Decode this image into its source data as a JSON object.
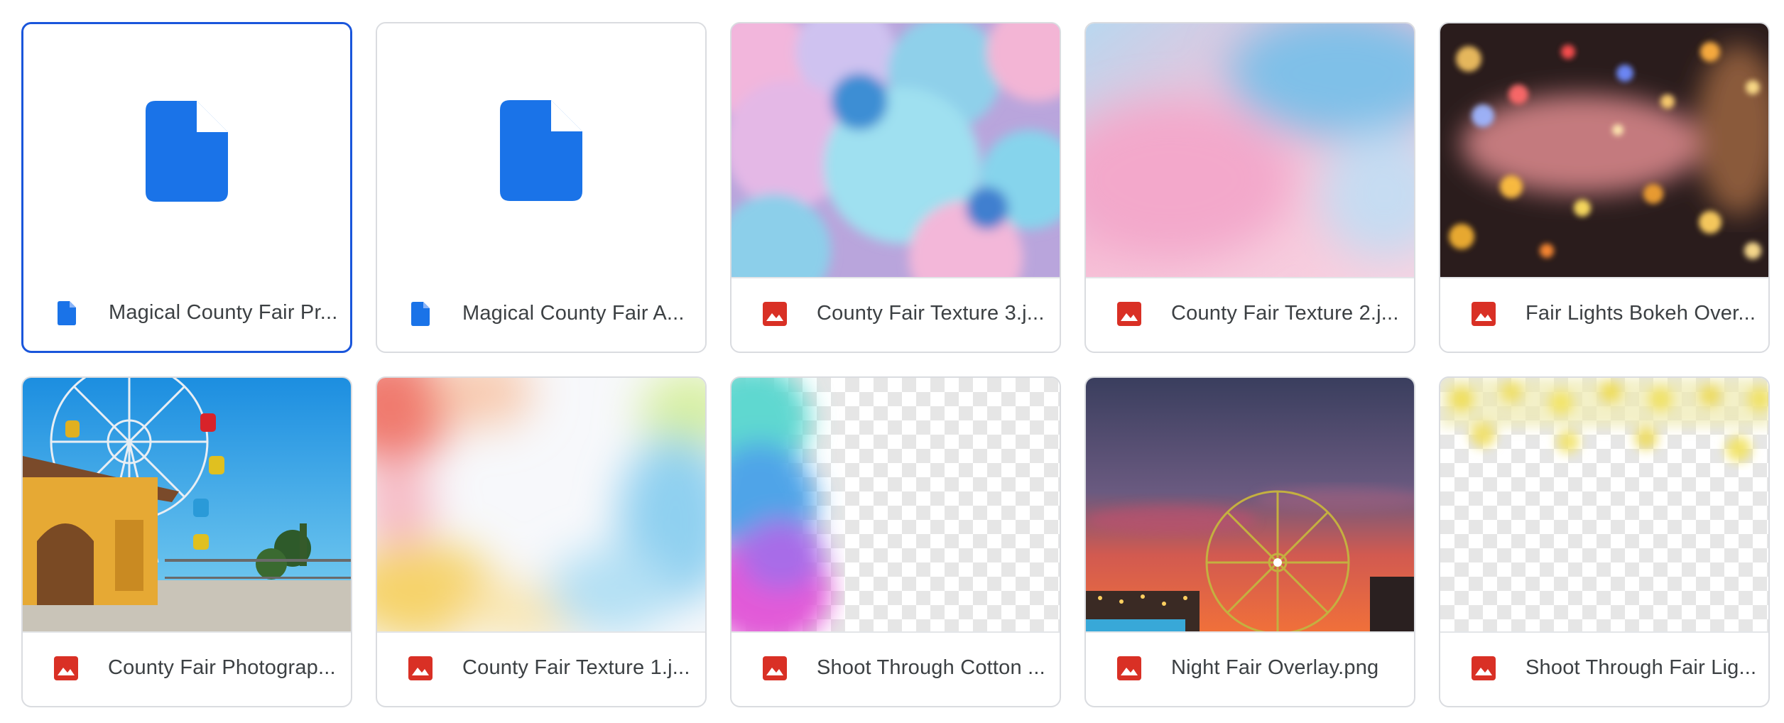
{
  "colors": {
    "doc_blue": "#1a73e8",
    "image_red": "#d93025",
    "selected_border": "#1a56db",
    "card_border": "#dadce0",
    "text": "#3c4043"
  },
  "files": [
    {
      "name": "Magical County Fair Pr...",
      "type": "document",
      "icon": "document-icon",
      "selected": true
    },
    {
      "name": "Magical County Fair A...",
      "type": "document",
      "icon": "document-icon",
      "selected": false
    },
    {
      "name": "County Fair Texture 3.j...",
      "type": "image",
      "icon": "image-icon",
      "thumbnail": "pastel-bokeh-circles"
    },
    {
      "name": "County Fair Texture 2.j...",
      "type": "image",
      "icon": "image-icon",
      "thumbnail": "pink-blue-texture"
    },
    {
      "name": "Fair Lights Bokeh Over...",
      "type": "image",
      "icon": "image-icon",
      "thumbnail": "night-lights-bokeh"
    },
    {
      "name": "County Fair Photograp...",
      "type": "image",
      "icon": "image-icon",
      "thumbnail": "ferris-wheel-daytime"
    },
    {
      "name": "County Fair Texture 1.j...",
      "type": "image",
      "icon": "image-icon",
      "thumbnail": "rainbow-light-bokeh"
    },
    {
      "name": "Shoot Through Cotton ...",
      "type": "image",
      "icon": "image-icon",
      "thumbnail": "cotton-candy-transparent"
    },
    {
      "name": "Night Fair Overlay.png",
      "type": "image",
      "icon": "image-icon",
      "thumbnail": "ferris-wheel-night"
    },
    {
      "name": "Shoot Through Fair Lig...",
      "type": "image",
      "icon": "image-icon",
      "thumbnail": "string-lights-transparent"
    }
  ]
}
